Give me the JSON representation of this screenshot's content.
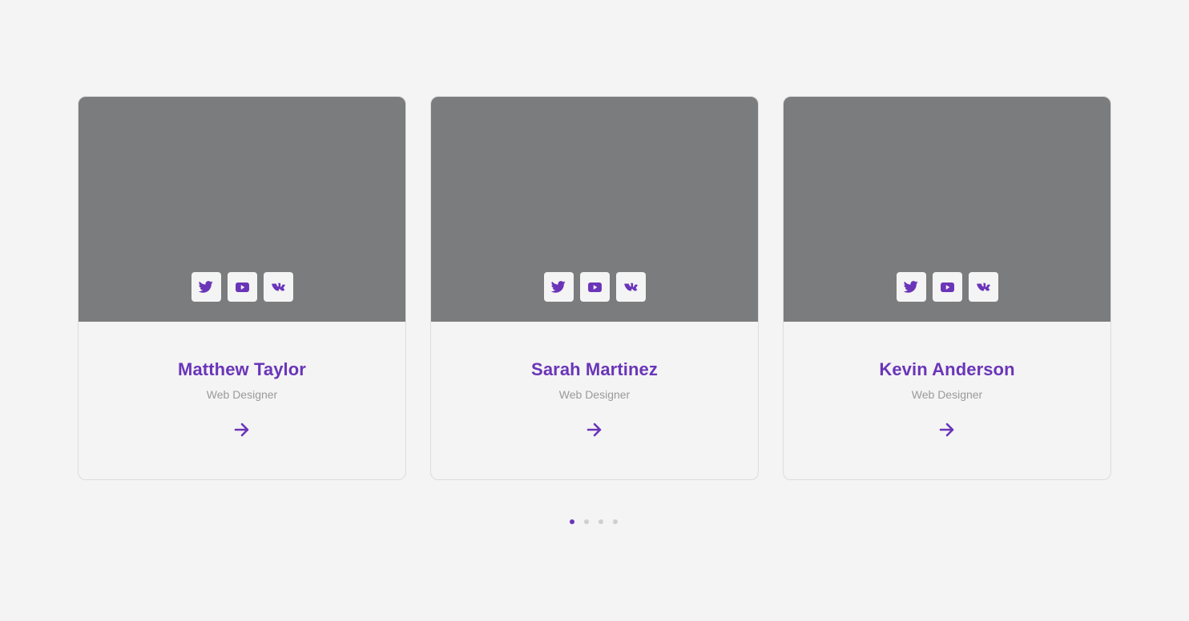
{
  "accent_color": "#6a35b8",
  "team": [
    {
      "name": "Matthew Taylor",
      "role": "Web Designer",
      "socials": [
        "twitter-icon",
        "youtube-icon",
        "vk-icon"
      ]
    },
    {
      "name": "Sarah Martinez",
      "role": "Web Designer",
      "socials": [
        "twitter-icon",
        "youtube-icon",
        "vk-icon"
      ]
    },
    {
      "name": "Kevin Anderson",
      "role": "Web Designer",
      "socials": [
        "twitter-icon",
        "youtube-icon",
        "vk-icon"
      ]
    }
  ],
  "pagination": {
    "pages": 4,
    "active_page": 1
  }
}
